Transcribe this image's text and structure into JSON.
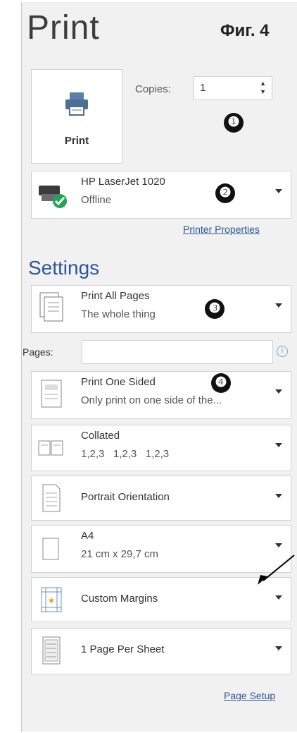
{
  "header": {
    "title": "Print",
    "figure_label": "Фиг. 4"
  },
  "print_button": {
    "label": "Print"
  },
  "copies": {
    "label": "Copies:",
    "value": "1"
  },
  "markers": [
    "❶",
    "❷",
    "❸",
    "❹"
  ],
  "printer": {
    "name": "HP LaserJet 1020",
    "status": "Offline",
    "properties_link": "Printer Properties"
  },
  "settings": {
    "heading": "Settings",
    "print_range": {
      "title": "Print All Pages",
      "subtitle": "The whole thing"
    },
    "pages": {
      "label": "Pages:",
      "value": ""
    },
    "sides": {
      "title": "Print One Sided",
      "subtitle": "Only print on one side of the..."
    },
    "collation": {
      "title": "Collated",
      "subtitle": "1,2,3   1,2,3   1,2,3"
    },
    "orientation": {
      "title": "Portrait Orientation"
    },
    "paper": {
      "title": "A4",
      "subtitle": "21 cm x 29,7 cm"
    },
    "margins": {
      "title": "Custom Margins"
    },
    "per_sheet": {
      "title": "1 Page Per Sheet"
    },
    "page_setup_link": "Page Setup"
  },
  "icons": [
    "printer-icon",
    "printer-status-icon",
    "pages-icon",
    "one-sided-icon",
    "collated-icon",
    "portrait-icon",
    "paper-icon",
    "margins-icon",
    "per-sheet-icon",
    "info-icon"
  ],
  "colors": {
    "accent": "#2b579a",
    "panel": "#f1f1f1",
    "offline_check": "#23a455"
  }
}
